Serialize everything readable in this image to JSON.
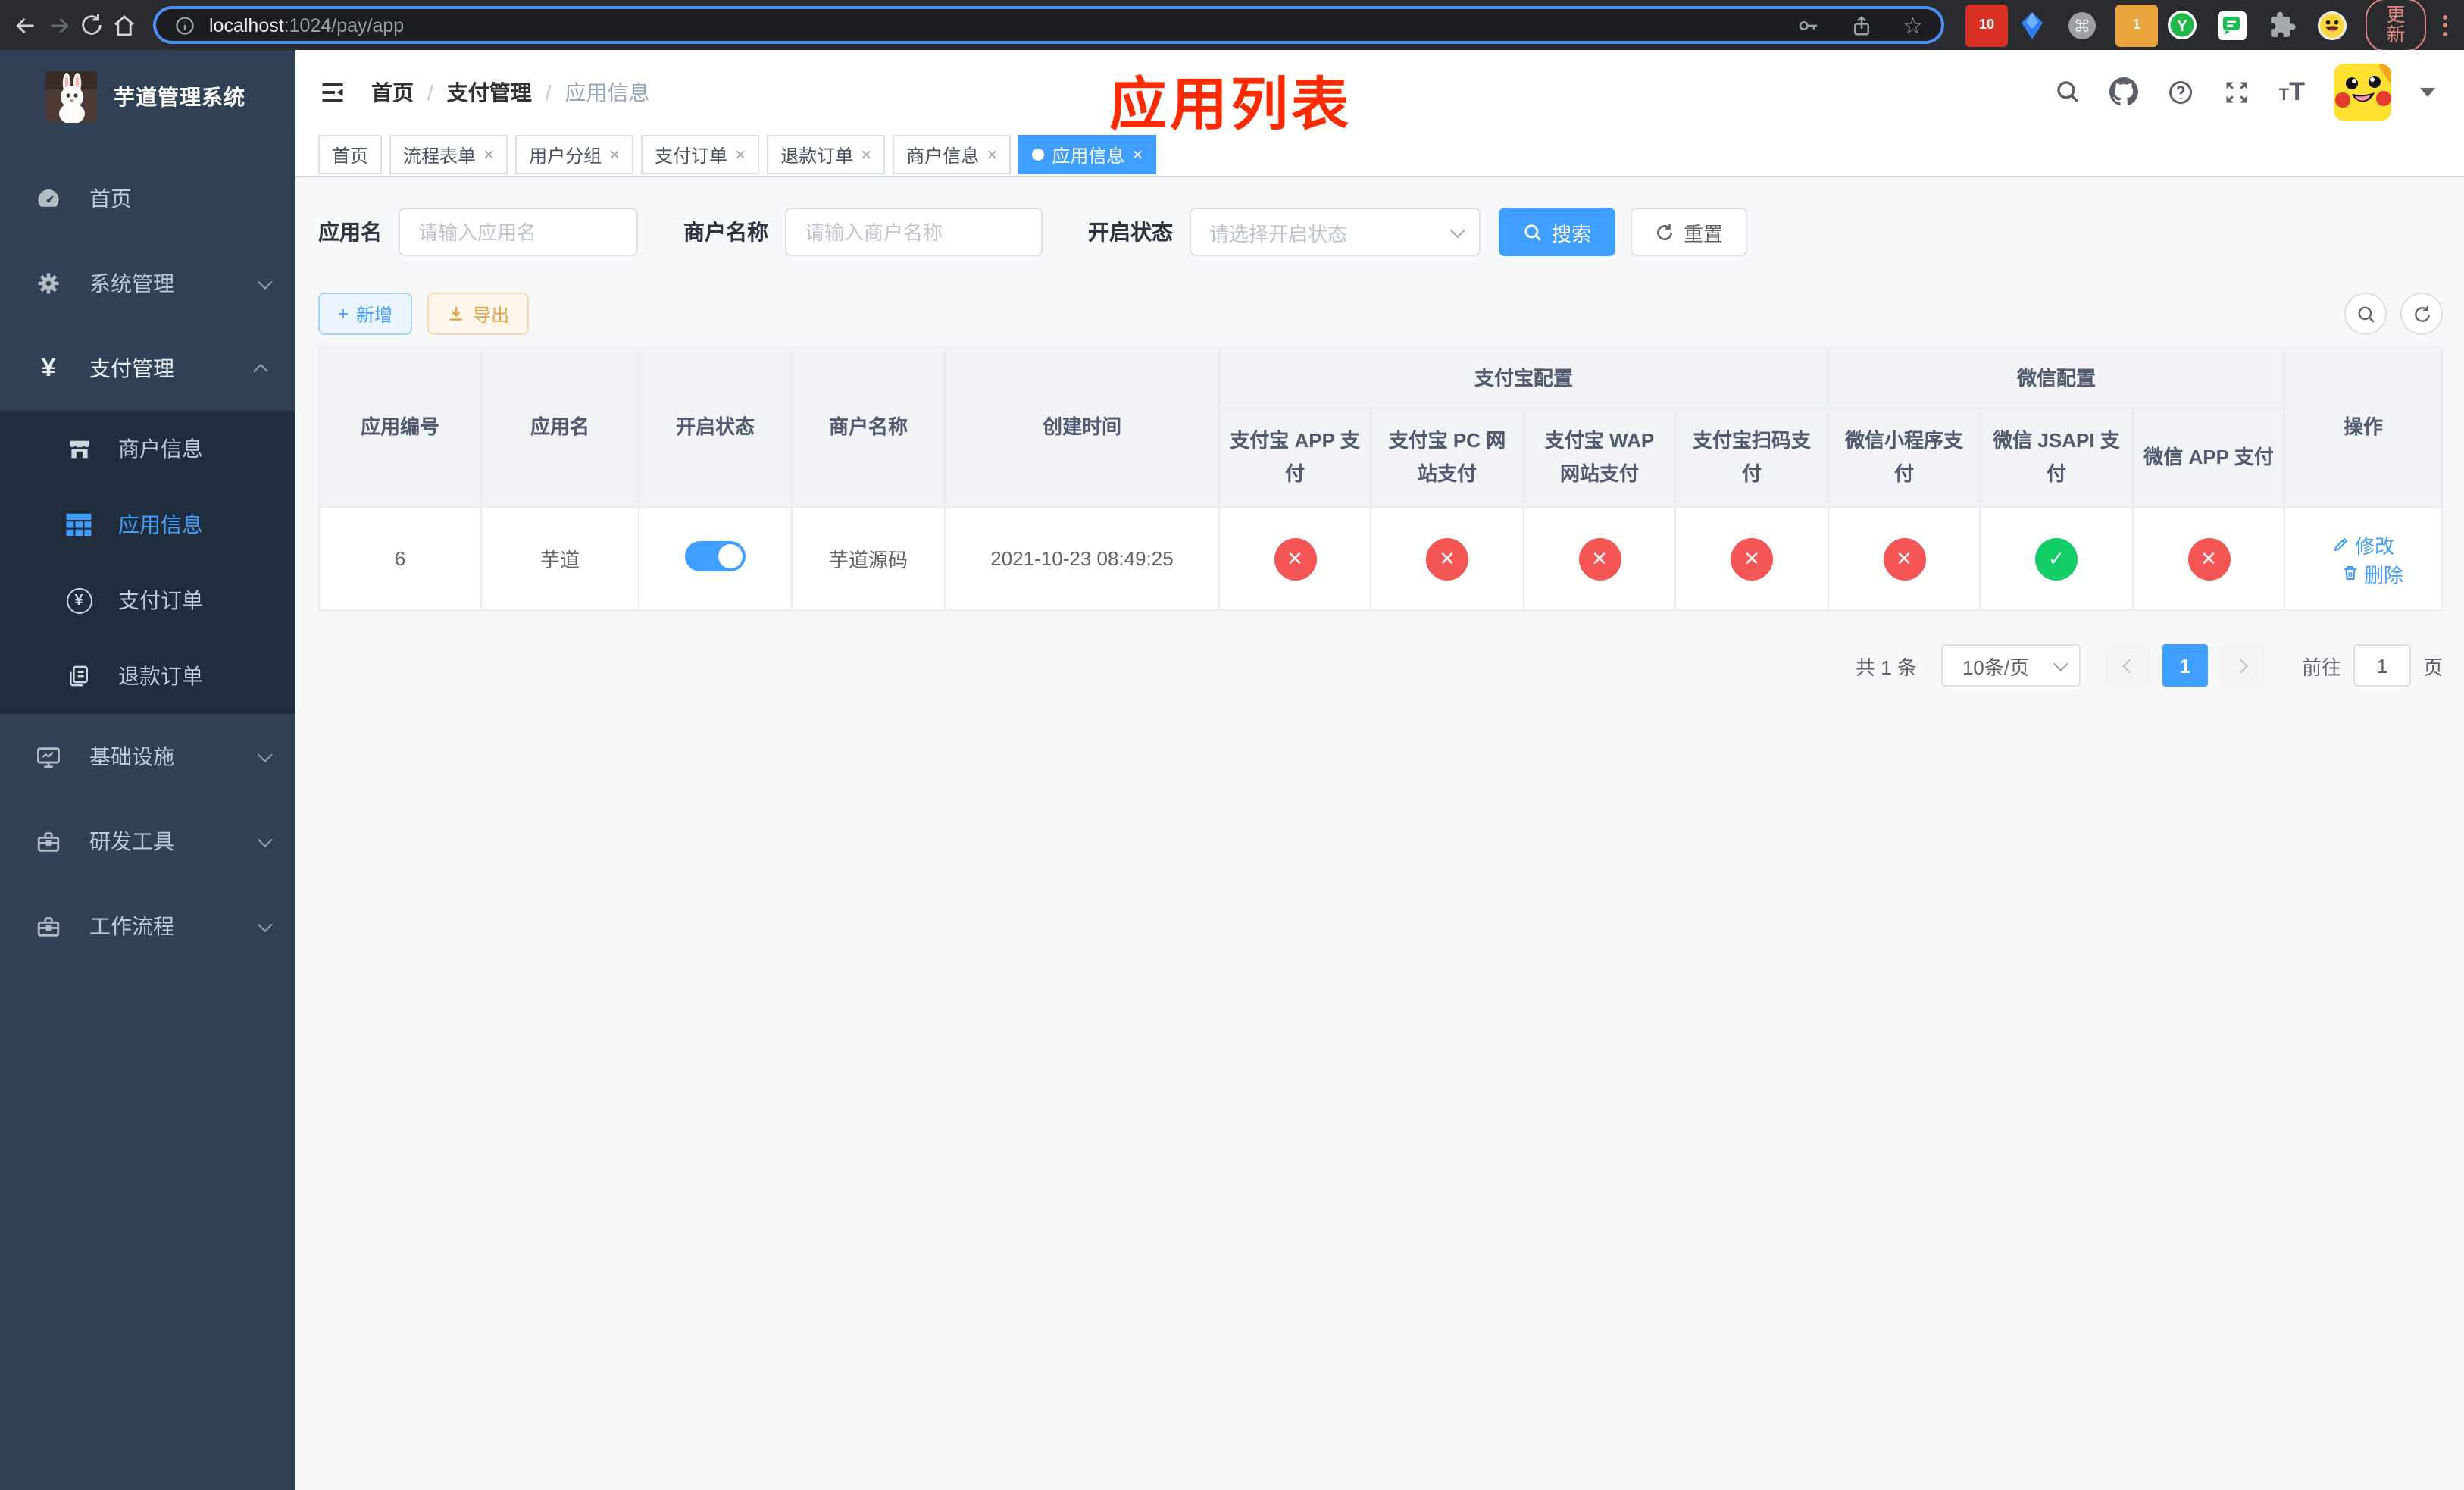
{
  "browser": {
    "url_host": "localhost",
    "url_rest": ":1024/pay/app",
    "update_button": "更新",
    "ext_badge_grid": "10",
    "ext_badge_circle": "1",
    "ext_y_letter": "Y"
  },
  "glyphs": {
    "close": "×",
    "slash": "/",
    "star": "☆",
    "yen": "¥",
    "cmd": "⌘",
    "plus": "+"
  },
  "sidebar": {
    "logo_title": "芋道管理系统",
    "items": [
      {
        "label": "首页"
      },
      {
        "label": "系统管理"
      },
      {
        "label": "支付管理"
      },
      {
        "label": "基础设施"
      },
      {
        "label": "研发工具"
      },
      {
        "label": "工作流程"
      }
    ],
    "pay_submenu": [
      {
        "label": "商户信息"
      },
      {
        "label": "应用信息",
        "active": true
      },
      {
        "label": "支付订单"
      },
      {
        "label": "退款订单"
      }
    ]
  },
  "header": {
    "breadcrumb": [
      "首页",
      "支付管理",
      "应用信息"
    ],
    "annotation": "应用列表"
  },
  "tabs": [
    {
      "label": "首页",
      "closable": false,
      "active": false
    },
    {
      "label": "流程表单",
      "closable": true,
      "active": false
    },
    {
      "label": "用户分组",
      "closable": true,
      "active": false
    },
    {
      "label": "支付订单",
      "closable": true,
      "active": false
    },
    {
      "label": "退款订单",
      "closable": true,
      "active": false
    },
    {
      "label": "商户信息",
      "closable": true,
      "active": false
    },
    {
      "label": "应用信息",
      "closable": true,
      "active": true
    }
  ],
  "filters": {
    "app_name_label": "应用名",
    "app_name_placeholder": "请输入应用名",
    "merchant_label": "商户名称",
    "merchant_placeholder": "请输入商户名称",
    "status_label": "开启状态",
    "status_placeholder": "请选择开启状态",
    "search_button": "搜索",
    "reset_button": "重置"
  },
  "toolbar": {
    "add_button": "新增",
    "export_button": "导出"
  },
  "table": {
    "columns": {
      "app_id": "应用编号",
      "app_name": "应用名",
      "status": "开启状态",
      "merchant": "商户名称",
      "create_time": "创建时间",
      "alipay_group": "支付宝配置",
      "wechat_group": "微信配置",
      "alipay_app": "支付宝 APP 支付",
      "alipay_pc": "支付宝 PC 网站支付",
      "alipay_wap": "支付宝 WAP 网站支付",
      "alipay_qr": "支付宝扫码支付",
      "wx_lite": "微信小程序支付",
      "wx_jsapi": "微信 JSAPI 支付",
      "wx_app": "微信 APP 支付",
      "actions": "操作"
    },
    "badge_glyphs": {
      "on": "✓",
      "off": "✕"
    },
    "row": {
      "app_id": "6",
      "app_name": "芋道",
      "status_on": true,
      "merchant": "芋道源码",
      "create_time": "2021-10-23 08:49:25",
      "channels": [
        false,
        false,
        false,
        false,
        false,
        true,
        false
      ],
      "edit_label": "修改",
      "delete_label": "删除"
    }
  },
  "pagination": {
    "total": "共 1 条",
    "page_size": "10条/页",
    "current_page": "1",
    "goto_label": "前往",
    "goto_value": "1",
    "page_suffix": "页"
  },
  "colors": {
    "accent": "#409eff",
    "danger": "#f45656",
    "success": "#13ce66",
    "annotation": "#ff2b00"
  }
}
